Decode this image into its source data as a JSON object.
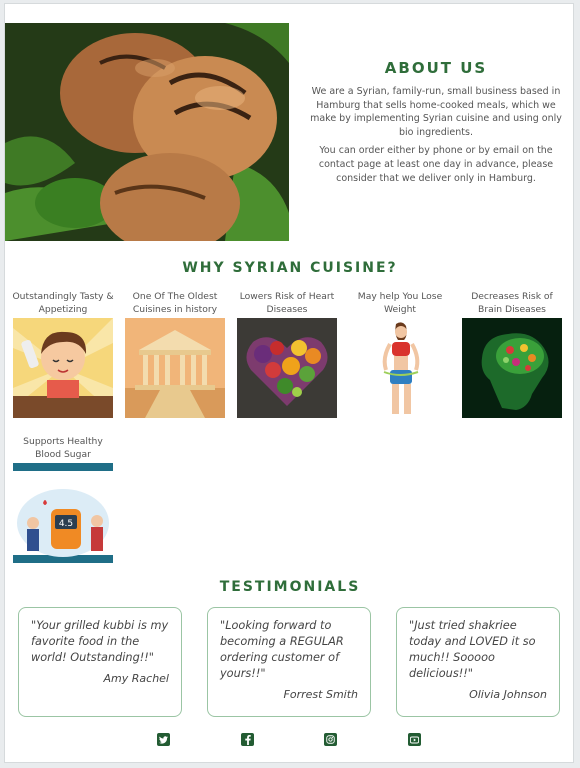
{
  "about": {
    "title": "ABOUT US",
    "p1": "We are a Syrian, family-run, small business based in Hamburg that sells home-cooked meals, which we make by implementing Syrian cuisine and using only bio ingredients.",
    "p2": "You can order either by phone or by email on the contact page at least one day in advance, please consider that we deliver only in Hamburg."
  },
  "why": {
    "title": "WHY SYRIAN CUISINE?",
    "items": [
      {
        "label": "Outstandingly Tasty & Appetizing",
        "icon": "happy-eater-image"
      },
      {
        "label": "One Of The Oldest Cuisines in history",
        "icon": "ancient-temple-image"
      },
      {
        "label": "Lowers Risk of Heart Diseases",
        "icon": "vegetable-heart-image"
      },
      {
        "label": "May help You Lose Weight",
        "icon": "fit-woman-image"
      },
      {
        "label": "Decreases Risk of Brain Diseases",
        "icon": "brain-image"
      },
      {
        "label": "Supports Healthy Blood Sugar",
        "icon": "glucose-meter-image"
      }
    ]
  },
  "testimonials": {
    "title": "TESTIMONIALS",
    "items": [
      {
        "quote": "\"Your grilled kubbi is my favorite food in the world! Outstanding!!\"",
        "author": "Amy Rachel"
      },
      {
        "quote": "\"Looking forward to becoming a REGULAR ordering customer of yours!!\"",
        "author": "Forrest Smith"
      },
      {
        "quote": "\"Just tried shakriee today and LOVED it so much!! Sooooo delicious!!\"",
        "author": "Olivia Johnson"
      }
    ]
  },
  "footer": {
    "icons": [
      "twitter-icon",
      "facebook-icon",
      "instagram-icon",
      "youtube-icon"
    ]
  },
  "colors": {
    "accent": "#2f6d3a",
    "card_border": "#9bc5a4",
    "icon_bg": "#235c33"
  }
}
